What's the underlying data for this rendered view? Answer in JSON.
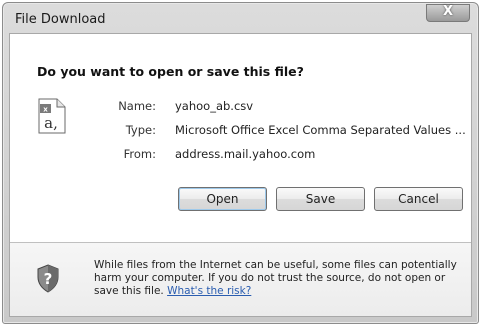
{
  "window": {
    "title": "File Download",
    "close_glyph": "X"
  },
  "dialog": {
    "question": "Do you want to open or save this file?",
    "file_icon": "excel-csv-file-icon",
    "fields": [
      {
        "label": "Name:",
        "value": "yahoo_ab.csv"
      },
      {
        "label": "Type:",
        "value": "Microsoft Office Excel Comma Separated Values ..."
      },
      {
        "label": "From:",
        "value": "address.mail.yahoo.com"
      }
    ],
    "buttons": {
      "open": "Open",
      "save": "Save",
      "cancel": "Cancel"
    }
  },
  "warning": {
    "icon": "shield-question-icon",
    "text": "While files from the Internet can be useful, some files can potentially harm your computer. If you do not trust the source, do not open or save this file.",
    "link": "What's the risk?"
  }
}
